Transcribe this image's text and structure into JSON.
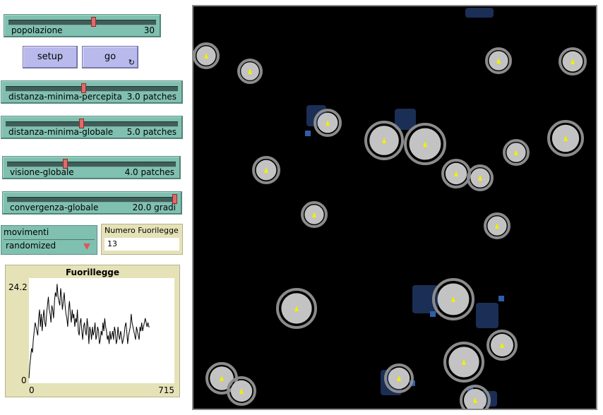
{
  "sliders": [
    {
      "id": "popolazione",
      "label": "popolazione",
      "value": "30",
      "fraction": 0.58
    },
    {
      "id": "distanza-minima-percepita",
      "label": "distanza-minima-percepita",
      "value": "3.0 patches",
      "fraction": 0.45
    },
    {
      "id": "distanza-minima-globale",
      "label": "distanza-minima-globale",
      "value": "5.0 patches",
      "fraction": 0.44
    },
    {
      "id": "visione-globale",
      "label": "visione-globale",
      "value": "4.0 patches",
      "fraction": 0.34
    },
    {
      "id": "convergenza-globale",
      "label": "convergenza-globale",
      "value": "20.0 gradi",
      "fraction": 1.0
    }
  ],
  "buttons": {
    "setup": "setup",
    "go": "go",
    "go_forever_icon": "↻"
  },
  "chooser": {
    "label": "movimenti",
    "value": "randomized"
  },
  "monitor": {
    "label": "Numero Fuorilegge",
    "value": "13"
  },
  "plot": {
    "title": "Fuorillegge",
    "ymax_label": "24.2",
    "ymin_label": "0",
    "xmin_label": "0",
    "xmax_label": "715"
  },
  "chart_data": {
    "type": "line",
    "title": "Fuorillegge",
    "xlim": [
      0,
      715
    ],
    "ylim": [
      0,
      24.2
    ],
    "series": [
      {
        "values": [
          1,
          4,
          6,
          8,
          7,
          10,
          12,
          14,
          13,
          12,
          11,
          15,
          17,
          13,
          16,
          12,
          15,
          17,
          14,
          13,
          16,
          18,
          20,
          17,
          16,
          14,
          18,
          17,
          15,
          19,
          21,
          20,
          23,
          20,
          19,
          18,
          22,
          20,
          17,
          19,
          21,
          18,
          16,
          15,
          13,
          17,
          19,
          16,
          14,
          17,
          15,
          16,
          13,
          15,
          14,
          17,
          12,
          11,
          14,
          15,
          12,
          10,
          13,
          14,
          12,
          11,
          15,
          13,
          9,
          13,
          12,
          10,
          13,
          11,
          12,
          14,
          10,
          11,
          13,
          12,
          9,
          10,
          12,
          11,
          14,
          12,
          15,
          13,
          12,
          10,
          11,
          9,
          12,
          10,
          11,
          12,
          10,
          13,
          12,
          9,
          10,
          13,
          11,
          10,
          12,
          11,
          9,
          10,
          11,
          13,
          14,
          12,
          9,
          11,
          12,
          13,
          16,
          14,
          13,
          12,
          11,
          10,
          13,
          12,
          11,
          10,
          13,
          12,
          14,
          12,
          13,
          14,
          15,
          14,
          13,
          14,
          13,
          13
        ]
      }
    ]
  },
  "world": {
    "background": "#000000",
    "border_color": "#8a8a8a",
    "patch_colors": {
      "light": "#c3c3c3",
      "ring": "#8b8b8b",
      "outlaw_dark": "#1b2e55",
      "outlaw_blue": "#2f5da8",
      "agent": "#f0f000"
    }
  }
}
